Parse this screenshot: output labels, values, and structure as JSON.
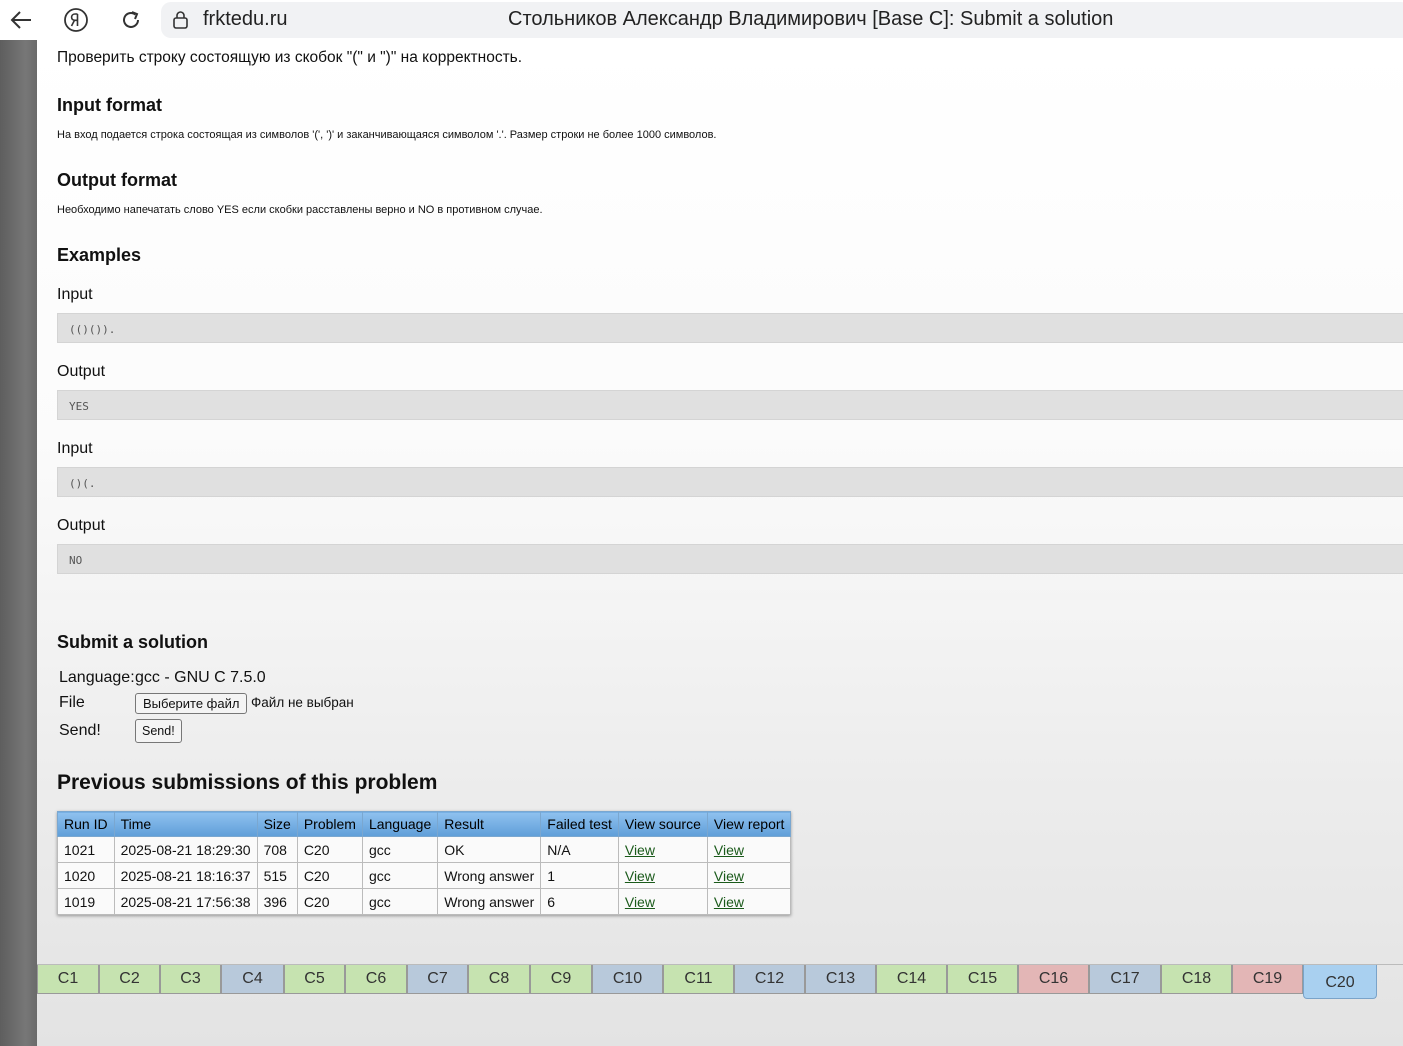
{
  "browser": {
    "url": "frktedu.ru",
    "title": "Стольников Александр Владимирович [Base C]: Submit a solution"
  },
  "problem": {
    "statement": "Проверить строку состоящую из скобок \"(\" и \")\" на корректность.",
    "input_format_title": "Input format",
    "input_format_text": "На вход подается строка состоящая из символов '(', ')' и заканчивающаяся символом '.'. Размер строки не более 1000 символов.",
    "output_format_title": "Output format",
    "output_format_text": "Необходимо напечатать слово YES если скобки расставлены верно и NO в противном случае.",
    "examples_title": "Examples",
    "examples": [
      {
        "input_label": "Input",
        "input": "(()()).",
        "output_label": "Output",
        "output": "YES"
      },
      {
        "input_label": "Input",
        "input": "()(.",
        "output_label": "Output",
        "output": "NO"
      }
    ]
  },
  "submit": {
    "title": "Submit a solution",
    "language_label": "Language:",
    "language_value": "gcc - GNU C 7.5.0",
    "file_label": "File",
    "file_button": "Выберите файл",
    "file_status": "Файл не выбран",
    "send_label": "Send!",
    "send_button": "Send!"
  },
  "previous": {
    "title": "Previous submissions of this problem",
    "headers": [
      "Run ID",
      "Time",
      "Size",
      "Problem",
      "Language",
      "Result",
      "Failed test",
      "View source",
      "View report"
    ],
    "rows": [
      [
        "1021",
        "2025-08-21 18:29:30",
        "708",
        "C20",
        "gcc",
        "OK",
        "N/A",
        "View",
        "View"
      ],
      [
        "1020",
        "2025-08-21 18:16:37",
        "515",
        "C20",
        "gcc",
        "Wrong answer",
        "1",
        "View",
        "View"
      ],
      [
        "1019",
        "2025-08-21 17:56:38",
        "396",
        "C20",
        "gcc",
        "Wrong answer",
        "6",
        "View",
        "View"
      ]
    ]
  },
  "tabs": [
    {
      "label": "C1",
      "status": "green"
    },
    {
      "label": "C2",
      "status": "green"
    },
    {
      "label": "C3",
      "status": "green"
    },
    {
      "label": "C4",
      "status": "blue"
    },
    {
      "label": "C5",
      "status": "green"
    },
    {
      "label": "C6",
      "status": "green"
    },
    {
      "label": "C7",
      "status": "blue"
    },
    {
      "label": "C8",
      "status": "green"
    },
    {
      "label": "C9",
      "status": "green"
    },
    {
      "label": "C10",
      "status": "blue"
    },
    {
      "label": "C11",
      "status": "green"
    },
    {
      "label": "C12",
      "status": "blue"
    },
    {
      "label": "C13",
      "status": "blue"
    },
    {
      "label": "C14",
      "status": "green"
    },
    {
      "label": "C15",
      "status": "green"
    },
    {
      "label": "C16",
      "status": "red"
    },
    {
      "label": "C17",
      "status": "blue"
    },
    {
      "label": "C18",
      "status": "green"
    },
    {
      "label": "C19",
      "status": "red"
    },
    {
      "label": "C20",
      "status": "active"
    }
  ],
  "colors": {
    "tab_green": "#c6e3b0",
    "tab_blue": "#b8c9db",
    "tab_red": "#e3b6b6",
    "tab_active": "#a9d0f0",
    "table_header": "#6faae0"
  },
  "icons": [
    "back-arrow-icon",
    "yandex-icon",
    "reload-icon",
    "lock-icon"
  ]
}
